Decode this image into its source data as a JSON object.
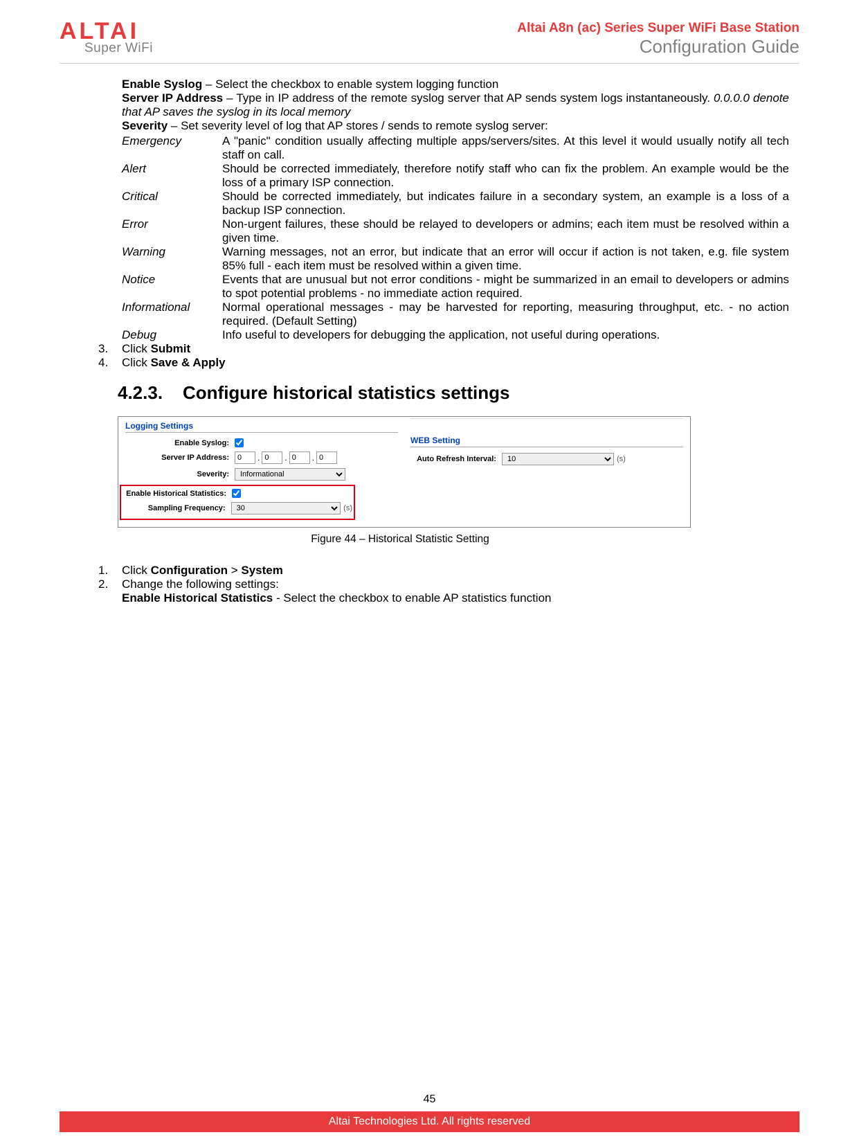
{
  "header": {
    "logo_main": "ALTAI",
    "logo_sub": "Super WiFi",
    "title1": "Altai A8n (ac) Series Super WiFi Base Station",
    "title2": "Configuration Guide"
  },
  "intro": {
    "enable_syslog_label": "Enable Syslog",
    "enable_syslog_text": " – Select the checkbox to enable system logging function",
    "server_ip_label": "Server IP Address",
    "server_ip_text": " – Type in IP address of the remote syslog server that AP sends system logs instantaneously. ",
    "server_ip_italic": "0.0.0.0 denote that AP saves the syslog in its local memory",
    "severity_label": "Severity",
    "severity_text": " – Set severity level of log that AP stores / sends to remote syslog server:"
  },
  "severity": [
    {
      "name": "Emergency",
      "desc": "A \"panic\" condition usually affecting multiple apps/servers/sites. At this level it would usually notify all tech staff on call."
    },
    {
      "name": "Alert",
      "desc": "Should be corrected immediately, therefore notify staff who can fix the problem. An example would be the loss of a primary ISP connection."
    },
    {
      "name": "Critical",
      "desc": "Should be corrected immediately, but indicates failure in a secondary system, an example is a loss of a backup ISP connection."
    },
    {
      "name": "Error",
      "desc": "Non-urgent failures, these should be relayed to developers or admins; each item must be resolved within a given time."
    },
    {
      "name": "Warning",
      "desc": "Warning messages, not an error, but indicate that an error will occur if action is not taken, e.g. file system 85% full - each item must be resolved within a given time."
    },
    {
      "name": "Notice",
      "desc": "Events that are unusual but not error conditions - might be summarized in an email to developers or admins to spot potential problems - no immediate action required."
    },
    {
      "name": "Informational",
      "desc": "Normal operational messages - may be harvested for reporting, measuring throughput, etc. - no action required. (Default Setting)"
    },
    {
      "name": "Debug",
      "desc": "Info useful to developers for debugging the application, not useful during operations."
    }
  ],
  "steps_a": {
    "s3_pre": "Click ",
    "s3_bold": "Submit",
    "s4_pre": "Click ",
    "s4_bold": "Save & Apply"
  },
  "section": {
    "num": "4.2.3.",
    "title": "Configure historical statistics settings"
  },
  "figure": {
    "logging_heading": "Logging Settings",
    "web_heading": "WEB Setting",
    "truncated_top": "",
    "enable_syslog": "Enable Syslog:",
    "server_ip": "Server IP Address:",
    "ip": [
      "0",
      "0",
      "0",
      "0"
    ],
    "severity_label": "Severity:",
    "severity_val": "Informational",
    "enable_hist": "Enable Historical Statistics:",
    "sampling": "Sampling Frequency:",
    "sampling_val": "30",
    "sampling_unit": "(s)",
    "auto_refresh": "Auto Refresh Interval:",
    "auto_refresh_val": "10",
    "auto_refresh_unit": "(s)",
    "caption": "Figure 44 – Historical Statistic Setting"
  },
  "steps_b": {
    "s1_pre": "Click ",
    "s1_b1": "Configuration",
    "s1_mid": " > ",
    "s1_b2": "System",
    "s2": "Change the following settings:",
    "s2a_bold": "Enable Historical Statistics",
    "s2a_text": " - Select the checkbox to enable AP statistics function"
  },
  "footer": {
    "page": "45",
    "bar": "Altai Technologies Ltd. All rights reserved"
  }
}
